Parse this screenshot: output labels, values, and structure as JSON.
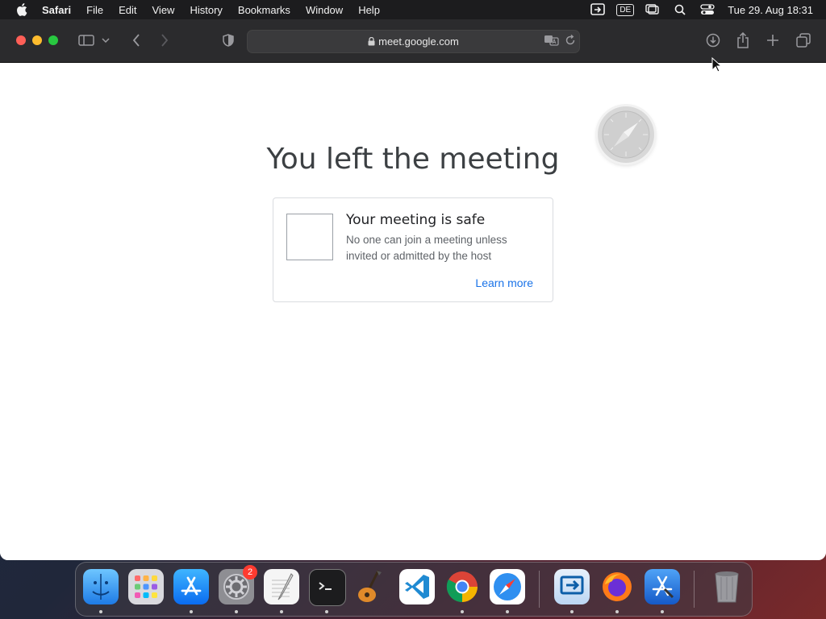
{
  "menubar": {
    "app_name": "Safari",
    "items": [
      "File",
      "Edit",
      "View",
      "History",
      "Bookmarks",
      "Window",
      "Help"
    ],
    "input_language": "DE",
    "clock": "Tue 29. Aug  18:31"
  },
  "browser": {
    "url": "meet.google.com"
  },
  "page": {
    "heading": "You left the meeting",
    "card": {
      "title": "Your meeting is safe",
      "body": "No one can join a meeting unless invited or admitted by the host",
      "link": "Learn more"
    }
  },
  "dock": {
    "apps": [
      "finder-icon",
      "launchpad-icon",
      "app-store-icon",
      "system-settings-icon",
      "textedit-icon",
      "terminal-icon",
      "garageband-icon",
      "vscode-icon",
      "chrome-icon",
      "safari-icon",
      "remote-desktop-icon",
      "firefox-icon",
      "xcode-icon",
      "trash-icon"
    ],
    "settings_badge": "2"
  },
  "colors": {
    "link": "#1a73e8",
    "heading": "#3c4043",
    "toolbar": "#2b2b2d"
  }
}
